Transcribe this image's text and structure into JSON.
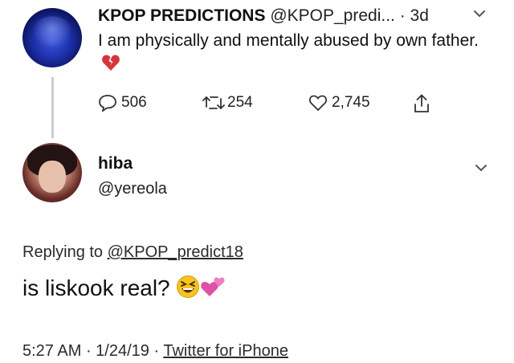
{
  "tweet1": {
    "display_name": "KPOP PREDICTIONS",
    "handle": "@KPOP_predi...",
    "time": "· 3d",
    "text": "I am physically and mentally abused by own father.",
    "replies": "506",
    "retweets": "254",
    "likes": "2,745",
    "avatar_icon": "blue-orb-avatar",
    "heart_emoji": "broken-heart-emoji"
  },
  "tweet2": {
    "display_name": "hiba",
    "handle": "@yereola",
    "replying_prefix": "Replying to ",
    "replying_handle": "@KPOP_predict18",
    "text": "is liskook real?",
    "time": "5:27 AM",
    "date": "1/24/19",
    "source": "Twitter for iPhone",
    "emojis": [
      "laughing-squint-emoji",
      "two-hearts-emoji"
    ]
  },
  "colors": {
    "text": "#111111",
    "thread_line": "#c9ccd1",
    "heart_red": "#d8343b",
    "two_hearts_pink": "#e04fa8",
    "emoji_yellow": "#f6c323"
  }
}
